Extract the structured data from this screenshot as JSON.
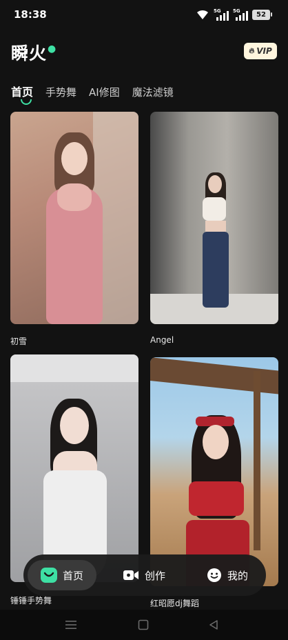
{
  "status_bar": {
    "time": "18:38",
    "signal1_tag": "5G",
    "signal2_tag": "5G",
    "battery": "52"
  },
  "header": {
    "logo": "瞬火",
    "vip_label": "VIP"
  },
  "tabs": [
    {
      "label": "首页",
      "active": true
    },
    {
      "label": "手势舞",
      "active": false
    },
    {
      "label": "AI修图",
      "active": false
    },
    {
      "label": "魔法滤镜",
      "active": false
    }
  ],
  "feed": [
    {
      "title": "初雪"
    },
    {
      "title": "Angel"
    },
    {
      "title": "锤锤手势舞"
    },
    {
      "title": "红昭愿dj舞蹈"
    }
  ],
  "bottom_nav": [
    {
      "label": "首页",
      "icon": "home-face-icon",
      "active": true
    },
    {
      "label": "创作",
      "icon": "video-camera-icon",
      "active": false
    },
    {
      "label": "我的",
      "icon": "smiley-icon",
      "active": false
    }
  ],
  "colors": {
    "accent": "#3ee0a4",
    "background": "#121212",
    "vip_bg": "#fff6de"
  }
}
